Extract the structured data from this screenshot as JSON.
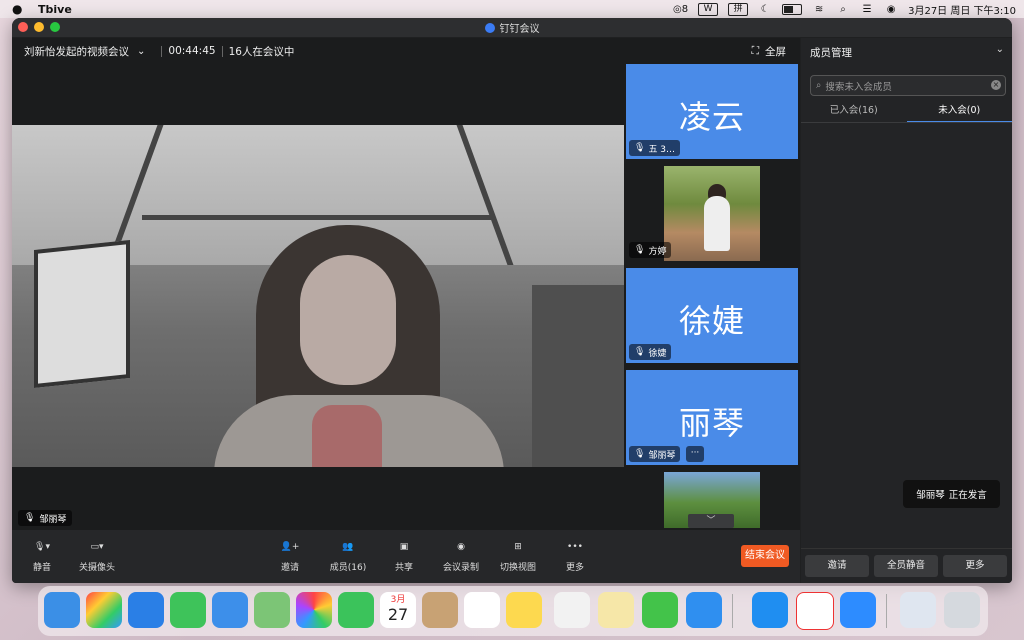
{
  "menubar": {
    "app_name": "Tbive",
    "badge": "8",
    "wps": "W",
    "ime": "拼",
    "datetime": "3月27日 周日 下午3:10"
  },
  "window": {
    "title": "钉钉会议"
  },
  "meeting": {
    "title": "刘新怡发起的视频会议",
    "duration": "00:44:45",
    "participants_status": "16人在会议中",
    "fullscreen_label": "全屏",
    "main_speaker_name": "邹丽琴"
  },
  "gallery": {
    "tiles": [
      {
        "big_name": "凌云",
        "tag": "五 3…"
      },
      {
        "big_name": "",
        "tag": "方婷"
      },
      {
        "big_name": "徐婕",
        "tag": "徐婕"
      },
      {
        "big_name": "丽琴",
        "tag": "邹丽琴"
      }
    ],
    "more_label": "···"
  },
  "toolbar": {
    "mute": "静音",
    "camera_off": "关摄像头",
    "invite": "邀请",
    "members": "成员(16)",
    "share": "共享",
    "record": "会议录制",
    "switch_view": "切换视图",
    "more": "更多",
    "end_meeting": "结束会议"
  },
  "panel": {
    "title": "成员管理",
    "search_placeholder": "搜索未入会成员",
    "tab_joined": "已入会(16)",
    "tab_not_joined": "未入会(0)",
    "speaking_name": "邹丽琴",
    "speaking_label": "正在发言",
    "invite_btn": "邀请",
    "mute_all_btn": "全员静音",
    "more_btn": "更多"
  },
  "dock": {
    "calendar_month": "3月",
    "calendar_day": "27"
  },
  "colors": {
    "accent_blue": "#4a8be8",
    "end_red": "#f05a23"
  }
}
